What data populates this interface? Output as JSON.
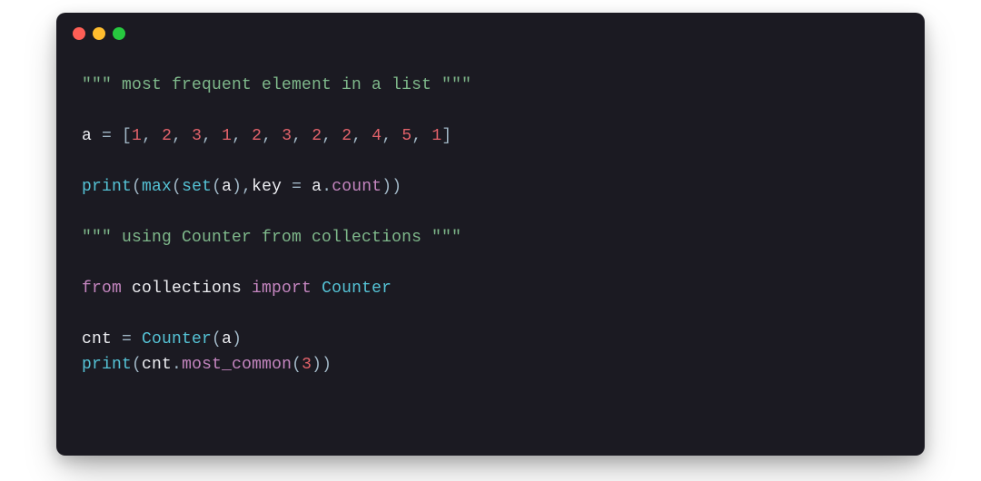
{
  "window": {
    "buttons": {
      "close": "close",
      "minimize": "minimize",
      "zoom": "zoom"
    }
  },
  "code": {
    "l1_docq": "\"\"\"",
    "l1_doc": " most frequent element in a list ",
    "l1_docq2": "\"\"\"",
    "l3_a": "a",
    "l3_eq": " = ",
    "l3_lb": "[",
    "l3_n1": "1",
    "l3_c1": ", ",
    "l3_n2": "2",
    "l3_c2": ", ",
    "l3_n3": "3",
    "l3_c3": ", ",
    "l3_n4": "1",
    "l3_c4": ", ",
    "l3_n5": "2",
    "l3_c5": ", ",
    "l3_n6": "3",
    "l3_c6": ", ",
    "l3_n7": "2",
    "l3_c7": ", ",
    "l3_n8": "2",
    "l3_c8": ", ",
    "l3_n9": "4",
    "l3_c9": ", ",
    "l3_n10": "5",
    "l3_c10": ", ",
    "l3_n11": "1",
    "l3_rb": "]",
    "l5_print": "print",
    "l5_po1": "(",
    "l5_max": "max",
    "l5_po2": "(",
    "l5_set": "set",
    "l5_po3": "(",
    "l5_a": "a",
    "l5_pc3": ")",
    "l5_com": ",",
    "l5_key": "key",
    "l5_eq": " = ",
    "l5_a2": "a",
    "l5_dot": ".",
    "l5_count": "count",
    "l5_pc2": ")",
    "l5_pc1": ")",
    "l7_docq": "\"\"\"",
    "l7_doc": " using Counter from collections ",
    "l7_docq2": "\"\"\"",
    "l9_from": "from",
    "l9_mod": " collections ",
    "l9_import": "import",
    "l9_cls": " Counter",
    "l11_cnt": "cnt",
    "l11_eq": " = ",
    "l11_cls": "Counter",
    "l11_po": "(",
    "l11_a": "a",
    "l11_pc": ")",
    "l12_print": "print",
    "l12_po1": "(",
    "l12_cnt": "cnt",
    "l12_dot": ".",
    "l12_mc": "most_common",
    "l12_po2": "(",
    "l12_n": "3",
    "l12_pc2": ")",
    "l12_pc1": ")"
  }
}
